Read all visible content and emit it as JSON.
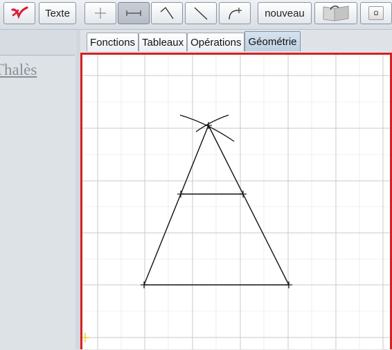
{
  "toolbar": {
    "app_logo_icon": "red-check-logo-icon",
    "text_button_label": "Texte",
    "point_tool_icon": "plus-point-icon",
    "segment_tool_icon": "segment-icon",
    "angle_tool_icon": "angle-icon",
    "line_tool_icon": "line-icon",
    "arc_tool_icon": "arc-plus-icon",
    "new_button_label": "nouveau",
    "book_icon": "open-book-icon",
    "keyboard_icon": "omega-key-icon",
    "omega_glyph": "Ω"
  },
  "left_panel": {
    "heading": "Thalès"
  },
  "tabs": [
    {
      "label": "Fonctions",
      "active": false
    },
    {
      "label": "Tableaux",
      "active": false
    },
    {
      "label": "Opérations",
      "active": false
    },
    {
      "label": "Géométrie",
      "active": true
    }
  ],
  "canvas": {
    "border_color": "#d42222",
    "grid_color": "#c8c8c8",
    "stroke_color": "#111111"
  }
}
